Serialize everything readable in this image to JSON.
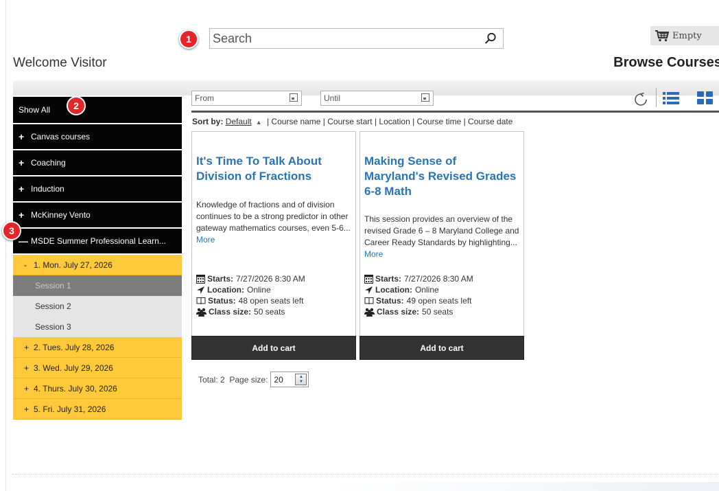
{
  "markers": [
    "1",
    "2",
    "3"
  ],
  "search": {
    "placeholder": "Search",
    "icon": "magnifier-icon"
  },
  "cart": {
    "label": "Empty",
    "icon": "cart-icon"
  },
  "header": {
    "welcome": "Welcome Visitor",
    "browse": "Browse Courses"
  },
  "sidebar": {
    "show_all": "Show All",
    "categories": [
      {
        "prefix": "+",
        "label": "Canvas courses"
      },
      {
        "prefix": "+",
        "label": "Coaching"
      },
      {
        "prefix": "+",
        "label": "Induction"
      },
      {
        "prefix": "+",
        "label": "McKinney Vento"
      },
      {
        "prefix": "—",
        "label": "MSDE Summer Professional Learn..."
      }
    ],
    "days": [
      {
        "prefix": "-",
        "label": "1. Mon. July 27, 2026"
      },
      {
        "prefix": "+",
        "label": "2. Tues. July 28, 2026"
      },
      {
        "prefix": "+",
        "label": "3. Wed. July 29, 2026"
      },
      {
        "prefix": "+",
        "label": "4. Thurs. July 30, 2026"
      },
      {
        "prefix": "+",
        "label": "5. Fri. July 31, 2026"
      }
    ],
    "sessions": [
      "Session 1",
      "Session 2",
      "Session 3"
    ]
  },
  "filters": {
    "from_placeholder": "From",
    "until_placeholder": "Until"
  },
  "views": {
    "refresh_icon": "refresh-icon",
    "list_icon": "list-view-icon",
    "grid_icon": "grid-view-icon"
  },
  "sort": {
    "label": "Sort by:",
    "default": "Default",
    "options": "| Course name | Course start | Location | Course time | Course date"
  },
  "courses": [
    {
      "title": "It's Time To Talk About Division of Fractions",
      "desc": "Knowledge of fractions and of division continues to be a strong predictor in other gateway mathematics courses, even 5-6...",
      "more": "More",
      "starts_label": "Starts:",
      "starts": "7/27/2026 8:30 AM",
      "location_label": "Location:",
      "location": "Online",
      "status_label": "Status:",
      "status": "48 open seats left",
      "size_label": "Class size:",
      "size": "50 seats",
      "add": "Add to cart"
    },
    {
      "title": "Making Sense of Maryland's Revised Grades 6-8 Math",
      "desc": "This session provides an overview of the revised Grade 6 – 8 Maryland College and Career Ready Standards by highlighting...",
      "more": "More",
      "starts_label": "Starts:",
      "starts": "7/27/2026 8:30 AM",
      "location_label": "Location:",
      "location": "Online",
      "status_label": "Status:",
      "status": "49 open seats left",
      "size_label": "Class size:",
      "size": "50 seats",
      "add": "Add to cart"
    }
  ],
  "pager": {
    "total": "Total: 2",
    "page_size_label": "Page size:",
    "page_size": "20"
  },
  "colors": {
    "accent": "#2b74b1",
    "marker": "#e3262a",
    "highlight": "#fec93a",
    "nav": "#050505"
  }
}
